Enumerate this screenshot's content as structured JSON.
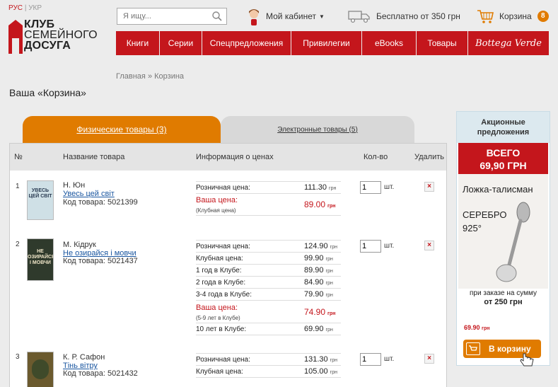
{
  "lang": {
    "ru": "РУС",
    "sep": "|",
    "ua": "УКР"
  },
  "logo": {
    "line1": "КЛУБ",
    "line2": "СЕМЕЙНОГО",
    "line3": "ДОСУГА"
  },
  "search": {
    "placeholder": "Я ищу..."
  },
  "header": {
    "cabinet": "Мой кабинет",
    "shipping": "Бесплатно от 350 грн",
    "cart": "Корзина",
    "cart_count": "8"
  },
  "nav": [
    "Книги",
    "Серии",
    "Спецпредложения",
    "Привилегии",
    "eBooks",
    "Товары",
    "Bottega Verde"
  ],
  "breadcrumb": {
    "home": "Главная",
    "sep": "»",
    "current": "Корзина"
  },
  "page_title": "Ваша «Корзина»",
  "tabs": {
    "physical": "Физические товары (3)",
    "ebooks": "Электронные товары (5)"
  },
  "table_headers": {
    "num": "№",
    "name": "Название товара",
    "price": "Информация о ценах",
    "qty": "Кол-во",
    "delete": "Удалить"
  },
  "items": [
    {
      "num": "1",
      "author": "Н. Юн",
      "title": "Увесь цей світ",
      "code": "Код товара: 5021399",
      "cover_text": "УВЕСЬ ЦЕЙ СВІТ",
      "prices": [
        {
          "label": "Розничная цена:",
          "value": "111.30",
          "unit": "грн"
        }
      ],
      "your_price": {
        "label": "Ваша цена:",
        "sub": "(Клубная цена)",
        "value": "89.00",
        "unit": "грн"
      },
      "extra": [],
      "qty": "1",
      "qty_unit": "шт."
    },
    {
      "num": "2",
      "author": "М. Кідрук",
      "title": "Не озирайся і мовчи",
      "code": "Код товара: 5021437",
      "cover_text": "НЕ ОЗИРАЙСЯ І МОВЧИ",
      "prices": [
        {
          "label": "Розничная цена:",
          "value": "124.90",
          "unit": "грн"
        },
        {
          "label": "Клубная цена:",
          "value": "99.90",
          "unit": "грн"
        },
        {
          "label": "1 год в Клубе:",
          "value": "89.90",
          "unit": "грн"
        },
        {
          "label": "2 года в Клубе:",
          "value": "84.90",
          "unit": "грн"
        },
        {
          "label": "3-4 года в Клубе:",
          "value": "79.90",
          "unit": "грн"
        }
      ],
      "your_price": {
        "label": "Ваша цена:",
        "sub": "(5-9 лет в Клубе)",
        "value": "74.90",
        "unit": "грн"
      },
      "extra": [
        {
          "label": "10 лет в Клубе:",
          "value": "69.90",
          "unit": "грн"
        }
      ],
      "qty": "1",
      "qty_unit": "шт."
    },
    {
      "num": "3",
      "author": "К. Р. Сафон",
      "title": "Тінь вітру",
      "code": "Код товара: 5021432",
      "cover_text": "",
      "prices": [
        {
          "label": "Розничная цена:",
          "value": "131.30",
          "unit": "грн"
        },
        {
          "label": "Клубная цена:",
          "value": "105.00",
          "unit": "грн"
        }
      ],
      "your_price": null,
      "extra": [],
      "qty": "1",
      "qty_unit": "шт."
    }
  ],
  "delete_symbol": "×",
  "promo": {
    "heading": "Акционные предложения",
    "total_line1": "ВСЕГО",
    "total_line2": "69,90 ГРН",
    "product": "Ложка-талисман",
    "metal": "СЕРЕБРО",
    "fineness": "925°",
    "condition": "при заказе на сумму",
    "condition_amount": "от 250 грн",
    "price": "69.90",
    "price_unit": "грн",
    "button": "В корзину"
  },
  "colors": {
    "brand_red": "#c4161c",
    "accent_orange": "#e07b00",
    "link_blue": "#1a56a0"
  }
}
